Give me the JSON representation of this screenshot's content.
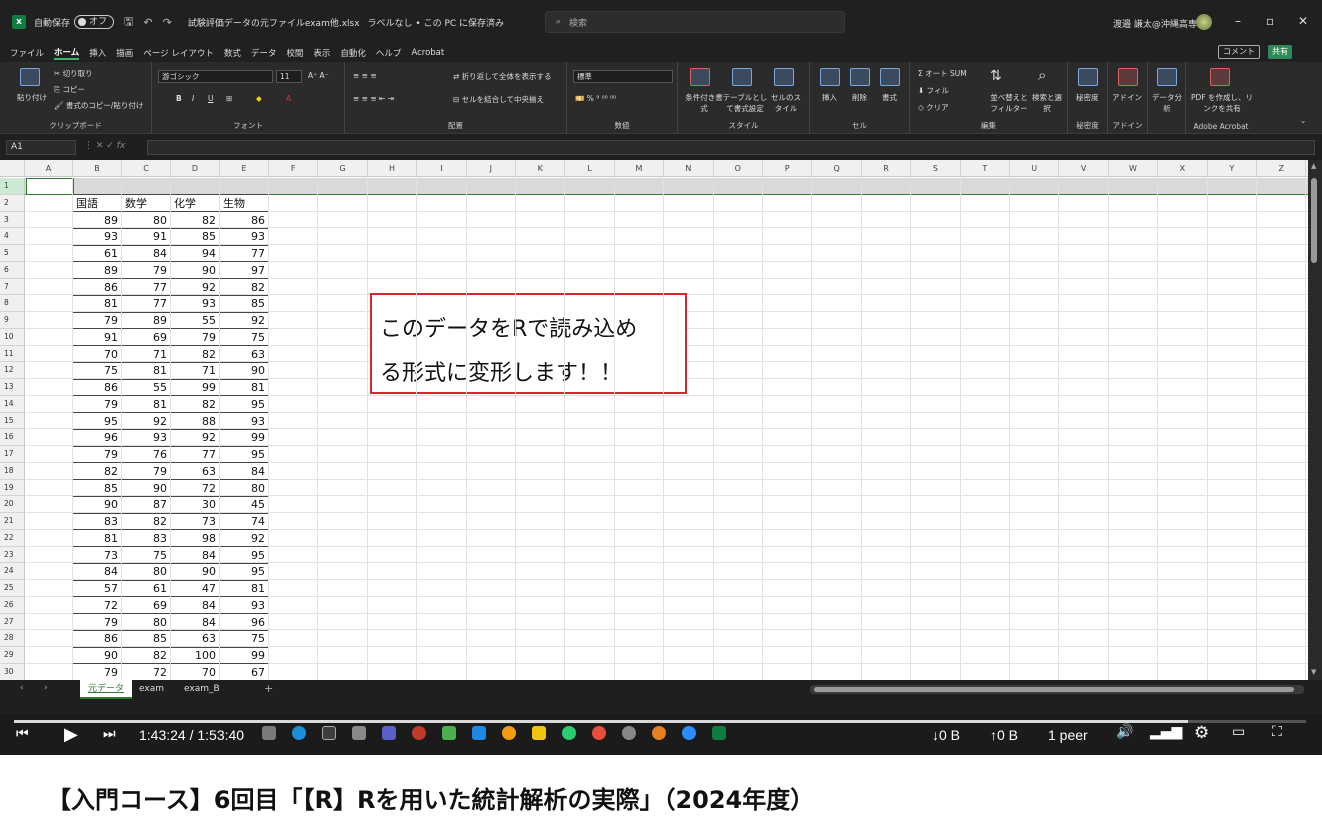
{
  "titlebar": {
    "autosave_label": "自動保存",
    "autosave_state": "オフ",
    "filename": "試験評価データの元ファイルexam他.xlsx",
    "label_status": "ラベルなし • この PC に保存済み",
    "search_placeholder": "検索",
    "user_name": "渡邉 謙太@沖縄高専"
  },
  "tabs": [
    "ファイル",
    "ホーム",
    "挿入",
    "描画",
    "ページ レイアウト",
    "数式",
    "データ",
    "校閲",
    "表示",
    "自動化",
    "ヘルプ",
    "Acrobat"
  ],
  "tab_active": "ホーム",
  "comment_label": "コメント",
  "share_label": "共有",
  "ribbon": {
    "clipboard": {
      "paste": "貼り付け",
      "cut": "切り取り",
      "copy": "コピー",
      "format_painter": "書式のコピー/貼り付け",
      "label": "クリップボード"
    },
    "font": {
      "name": "游ゴシック",
      "size": "11",
      "label": "フォント"
    },
    "alignment": {
      "wrap": "折り返して全体を表示する",
      "merge": "セルを結合して中央揃え",
      "label": "配置"
    },
    "number": {
      "format": "標準",
      "label": "数値"
    },
    "styles": {
      "conditional": "条件付き書式",
      "table": "テーブルとして書式設定",
      "cell": "セルのスタイル",
      "label": "スタイル"
    },
    "cells": {
      "insert": "挿入",
      "delete": "削除",
      "format": "書式",
      "label": "セル"
    },
    "editing": {
      "autosum": "オート SUM",
      "fill": "フィル",
      "clear": "クリア",
      "sort": "並べ替えとフィルター",
      "find": "検索と選択",
      "label": "編集"
    },
    "sensitivity": {
      "btn": "秘密度",
      "label": "秘密度"
    },
    "addins": {
      "btn": "アドイン",
      "label": "アドイン"
    },
    "analysis": {
      "btn": "データ分析"
    },
    "acrobat": {
      "btn": "PDF を作成し、リンクを共有",
      "label": "Adobe Acrobat"
    }
  },
  "formula_bar": {
    "cell_ref": "A1",
    "fx": "fx"
  },
  "columns": [
    "A",
    "B",
    "C",
    "D",
    "E",
    "F",
    "G",
    "H",
    "I",
    "J",
    "K",
    "L",
    "M",
    "N",
    "O",
    "P",
    "Q",
    "R",
    "S",
    "T",
    "U",
    "V",
    "W",
    "X",
    "Y",
    "Z"
  ],
  "headers": [
    "国語",
    "数学",
    "化学",
    "生物"
  ],
  "rows": [
    [
      89,
      80,
      82,
      86
    ],
    [
      93,
      91,
      85,
      93
    ],
    [
      61,
      84,
      94,
      77
    ],
    [
      89,
      79,
      90,
      97
    ],
    [
      86,
      77,
      92,
      82
    ],
    [
      81,
      77,
      93,
      85
    ],
    [
      79,
      89,
      55,
      92
    ],
    [
      91,
      69,
      79,
      75
    ],
    [
      70,
      71,
      82,
      63
    ],
    [
      75,
      81,
      71,
      90
    ],
    [
      86,
      55,
      99,
      81
    ],
    [
      79,
      81,
      82,
      95
    ],
    [
      95,
      92,
      88,
      93
    ],
    [
      96,
      93,
      92,
      99
    ],
    [
      79,
      76,
      77,
      95
    ],
    [
      82,
      79,
      63,
      84
    ],
    [
      85,
      90,
      72,
      80
    ],
    [
      90,
      87,
      30,
      45
    ],
    [
      83,
      82,
      73,
      74
    ],
    [
      81,
      83,
      98,
      92
    ],
    [
      73,
      75,
      84,
      95
    ],
    [
      84,
      80,
      90,
      95
    ],
    [
      57,
      61,
      47,
      81
    ],
    [
      72,
      69,
      84,
      93
    ],
    [
      79,
      80,
      84,
      96
    ],
    [
      86,
      85,
      63,
      75
    ],
    [
      90,
      82,
      100,
      99
    ],
    [
      79,
      72,
      70,
      67
    ]
  ],
  "callout": {
    "line1": "このデータをRで読み込め",
    "line2": "る形式に変形します！！"
  },
  "sheets": [
    "元データ",
    "exam",
    "exam_B"
  ],
  "active_sheet": "元データ",
  "video": {
    "time": "1:43:24 / 1:53:40",
    "down": "↓0 B",
    "up": "↑0 B",
    "peers": "1 peer",
    "progress_fraction": 0.909
  },
  "caption": "【入門コース】6回目「【R】Rを用いた統計解析の実際」（2024年度）"
}
